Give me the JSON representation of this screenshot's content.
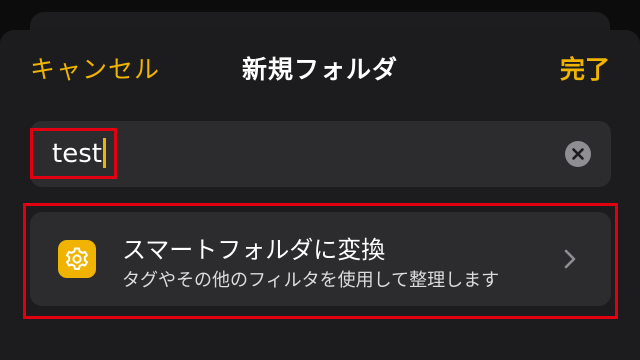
{
  "nav": {
    "cancel_label": "キャンセル",
    "title": "新規フォルダ",
    "done_label": "完了"
  },
  "name_field": {
    "value": "test"
  },
  "smart_folder": {
    "title": "スマートフォルダに変換",
    "subtitle": "タグやその他のフィルタを使用して整理します",
    "icon": "gear-icon"
  },
  "colors": {
    "accent": "#f0b400",
    "highlight": "#e0000f",
    "sheet_bg": "#1c1c1e",
    "field_bg": "#2c2c2e"
  }
}
